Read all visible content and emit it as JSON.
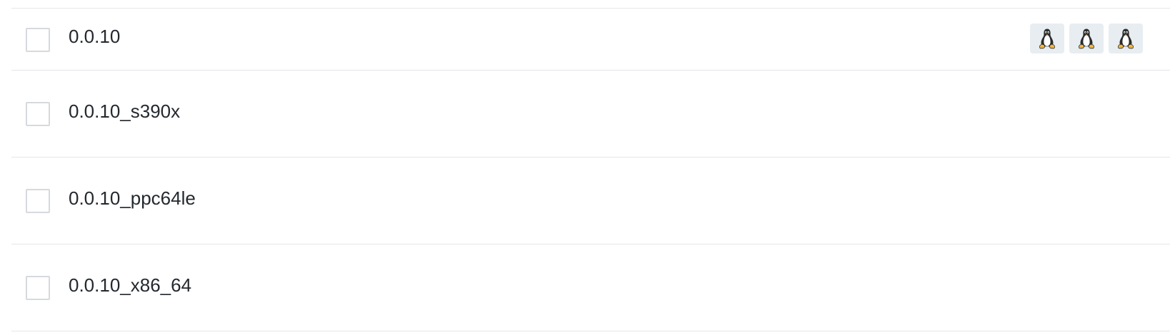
{
  "tags": [
    {
      "name": "0.0.10",
      "checked": false,
      "platforms": [
        {
          "icon": "linux-icon"
        },
        {
          "icon": "linux-icon"
        },
        {
          "icon": "linux-icon"
        }
      ]
    },
    {
      "name": "0.0.10_s390x",
      "checked": false,
      "platforms": []
    },
    {
      "name": "0.0.10_ppc64le",
      "checked": false,
      "platforms": []
    },
    {
      "name": "0.0.10_x86_64",
      "checked": false,
      "platforms": []
    }
  ],
  "colors": {
    "divider": "#e4e6ea",
    "badge_background": "#e7edf1",
    "checkbox_border": "#d6d9dd",
    "text": "#24292f"
  }
}
